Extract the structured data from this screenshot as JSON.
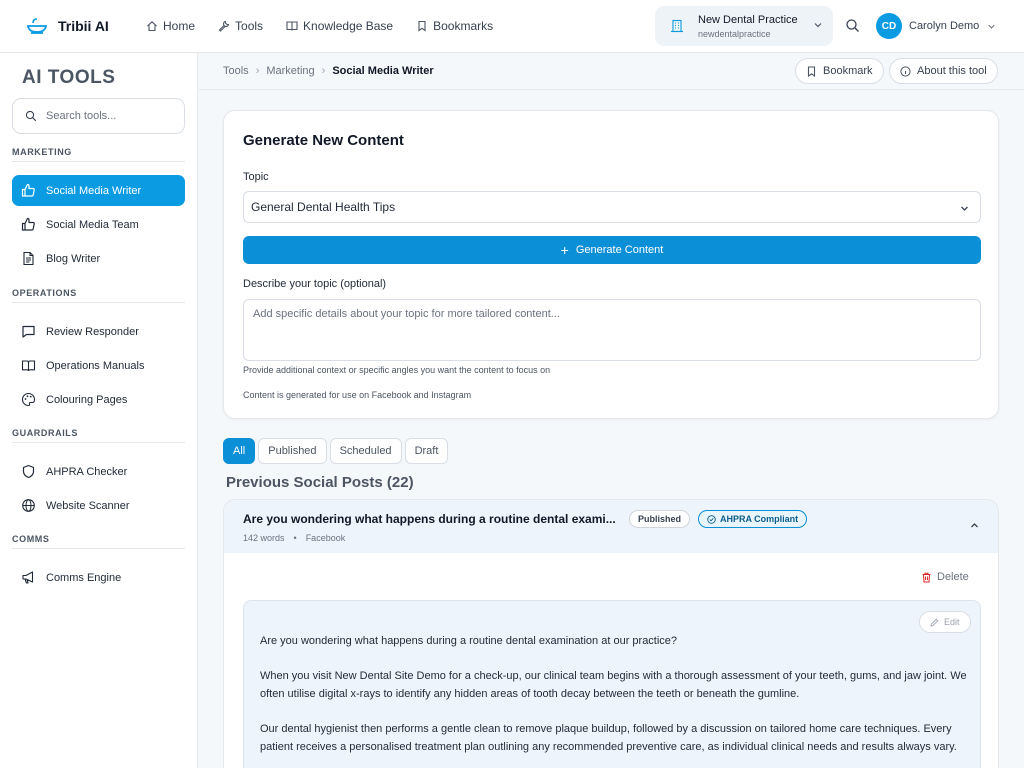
{
  "brand": {
    "name": "Tribii AI",
    "icon": "tub-logo-icon"
  },
  "nav": [
    {
      "label": "Home",
      "icon": "home-icon"
    },
    {
      "label": "Tools",
      "icon": "wrench-icon"
    },
    {
      "label": "Knowledge Base",
      "icon": "book-icon"
    },
    {
      "label": "Bookmarks",
      "icon": "bookmark-icon"
    }
  ],
  "practice": {
    "name": "New Dental Practice",
    "slug": "newdentalpractice"
  },
  "user": {
    "initials": "CD",
    "name": "Carolyn Demo"
  },
  "sidebar": {
    "title": "AI TOOLS",
    "search_placeholder": "Search tools...",
    "sections": [
      {
        "label": "MARKETING",
        "items": [
          {
            "label": "Social Media Writer",
            "icon": "thumbs-up-icon",
            "active": true
          },
          {
            "label": "Social Media Team",
            "icon": "thumbs-up-icon"
          },
          {
            "label": "Blog Writer",
            "icon": "document-icon"
          }
        ]
      },
      {
        "label": "OPERATIONS",
        "items": [
          {
            "label": "Review Responder",
            "icon": "chat-icon"
          },
          {
            "label": "Operations Manuals",
            "icon": "book-open-icon"
          },
          {
            "label": "Colouring Pages",
            "icon": "palette-icon"
          }
        ]
      },
      {
        "label": "GUARDRAILS",
        "items": [
          {
            "label": "AHPRA Checker",
            "icon": "shield-icon"
          },
          {
            "label": "Website Scanner",
            "icon": "globe-icon"
          }
        ]
      },
      {
        "label": "COMMS",
        "items": [
          {
            "label": "Comms Engine",
            "icon": "megaphone-icon"
          }
        ]
      }
    ]
  },
  "breadcrumb": [
    "Tools",
    "Marketing",
    "Social Media Writer"
  ],
  "actions": {
    "bookmark": "Bookmark",
    "about": "About this tool"
  },
  "generator": {
    "title": "Generate New Content",
    "topic_label": "Topic",
    "topic_value": "General Dental Health Tips",
    "generate_label": "Generate Content",
    "describe_label": "Describe your topic (optional)",
    "describe_placeholder": "Add specific details about your topic for more tailored content...",
    "hint": "Provide additional context or specific angles you want the content to focus on",
    "note": "Content is generated for use on Facebook and Instagram"
  },
  "filters": [
    "All",
    "Published",
    "Scheduled",
    "Draft"
  ],
  "posts_title": "Previous Social Posts (22)",
  "post": {
    "title": "Are you wondering what happens during a routine dental exami...",
    "status": "Published",
    "compliance": "AHPRA Compliant",
    "words": "142 words",
    "platform": "Facebook",
    "delete_label": "Delete",
    "edit_label": "Edit",
    "paragraphs": [
      "Are you wondering what happens during a routine dental examination at our practice?",
      "When you visit New Dental Site Demo for a check-up, our clinical team begins with a thorough assessment of your teeth, gums, and jaw joint. We often utilise digital x-rays to identify any hidden areas of tooth decay between the teeth or beneath the gumline.",
      "Our dental hygienist then performs a gentle clean to remove plaque buildup, followed by a discussion on tailored home care techniques. Every patient receives a personalised treatment plan outlining any recommended preventive care, as individual clinical needs and results always vary."
    ]
  },
  "colors": {
    "accent": "#0b9be3",
    "primary_button": "#0b8fd6",
    "compliance_border": "#0b8fd6"
  }
}
